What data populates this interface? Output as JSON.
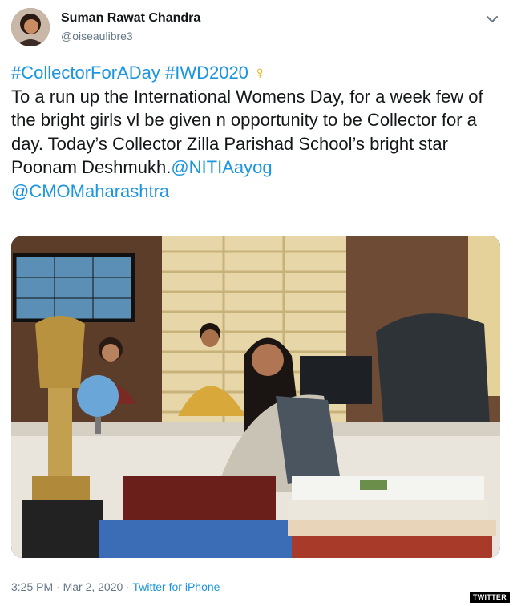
{
  "author": {
    "display_name": "Suman Rawat Chandra",
    "handle": "@oiseaulibre3"
  },
  "tweet": {
    "hashtag_1": "#CollectorForADay",
    "hashtag_2": "#IWD2020",
    "emoji": "♀",
    "text": "To a run up the International Womens Day, for a week few of the bright girls vl be given n opportunity to be Collector for a day. Today’s Collector Zilla Parishad School’s bright star Poonam Deshmukh.",
    "mention_1": "@NITIAayog",
    "mention_2": "@CMOMaharashtra"
  },
  "meta": {
    "timestamp": "3:25 PM · Mar 2, 2020 · ",
    "source": "Twitter for iPhone"
  },
  "watermark": "TWITTER",
  "icons": {
    "caret": "chevron-down-icon",
    "avatar": "profile-photo"
  },
  "colors": {
    "link": "#1b95e0",
    "text": "#14171a",
    "secondary": "#657786"
  }
}
